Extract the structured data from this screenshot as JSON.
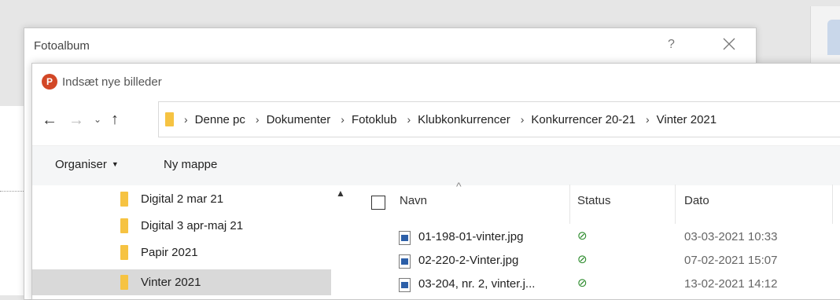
{
  "fotoalbum": {
    "title": "Fotoalbum",
    "help": "?"
  },
  "dialog": {
    "title": "Indsæt nye billeder",
    "app_icon_letter": "P"
  },
  "nav": {
    "back": "←",
    "forward": "→",
    "recent": "⌄",
    "up": "↑"
  },
  "address": {
    "separator": "›",
    "crumbs": [
      "Denne pc",
      "Dokumenter",
      "Fotoklub",
      "Klubkonkurrencer",
      "Konkurrencer 20-21",
      "Vinter 2021"
    ]
  },
  "toolbar": {
    "organise": "Organiser",
    "new_folder": "Ny mappe"
  },
  "tree": {
    "items": [
      {
        "label": "Digital 2 mar 21"
      },
      {
        "label": "Digital 3 apr-maj 21"
      },
      {
        "label": "Papir 2021"
      },
      {
        "label": "Vinter 2021",
        "selected": true
      }
    ]
  },
  "files": {
    "columns": {
      "name": "Navn",
      "status": "Status",
      "date": "Dato"
    },
    "rows": [
      {
        "name": "01-198-01-vinter.jpg",
        "status": "⊘",
        "date": "03-03-2021 10:33"
      },
      {
        "name": "02-220-2-Vinter.jpg",
        "status": "⊘",
        "date": "07-02-2021 15:07"
      },
      {
        "name": "03-204, nr. 2, vinter.j...",
        "status": "⊘",
        "date": "13-02-2021 14:12"
      }
    ]
  },
  "colors": {
    "folder": "#f6c342",
    "selected_row": "#d9d9d9",
    "status_ok": "#2a8a2a",
    "ppt": "#d24726"
  }
}
